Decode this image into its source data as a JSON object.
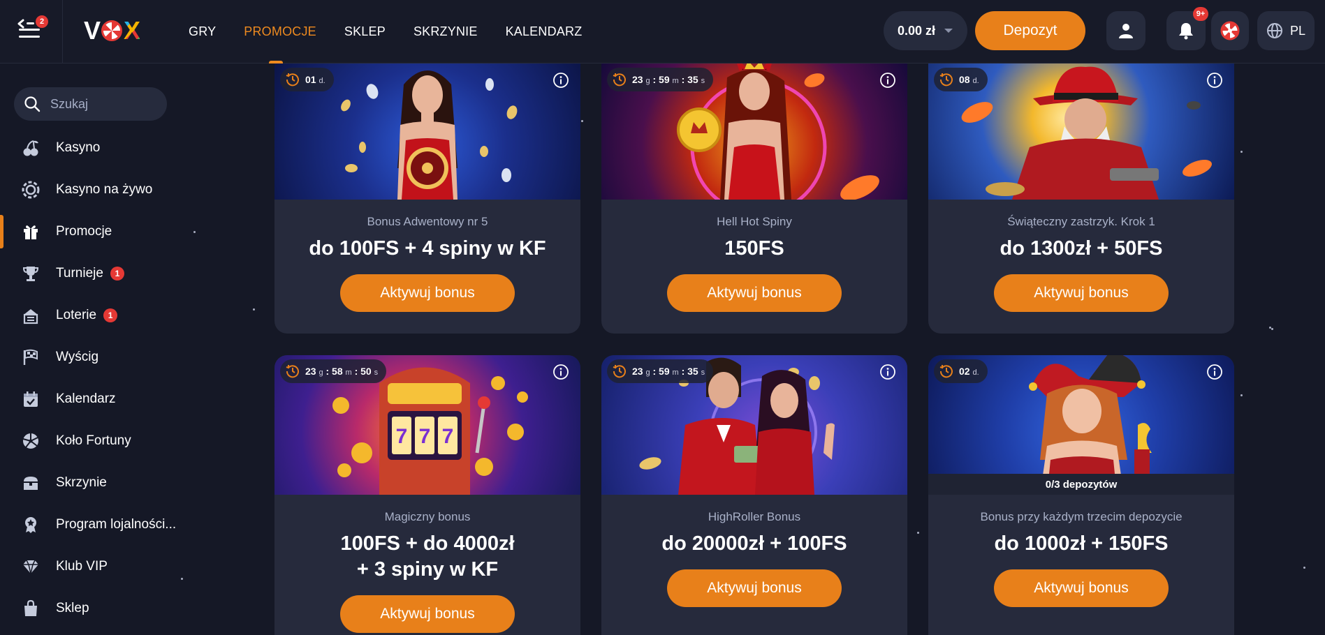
{
  "header": {
    "menu_badge": "2",
    "logo": "VOX",
    "nav": [
      "GRY",
      "PROMOCJE",
      "SKLEP",
      "SKRZYNIE",
      "KALENDARZ"
    ],
    "active_nav": "PROMOCJE",
    "balance": "0.00 zł",
    "deposit_label": "Depozyt",
    "notif_badge": "9+",
    "lang": "PL",
    "accent": "#e8801a"
  },
  "sidebar": {
    "search_placeholder": "Szukaj",
    "items": [
      {
        "label": "Kasyno",
        "icon": "cherries-icon"
      },
      {
        "label": "Kasyno na żywo",
        "icon": "live-chip-icon"
      },
      {
        "label": "Promocje",
        "icon": "gift-icon"
      },
      {
        "label": "Turnieje",
        "icon": "trophy-icon",
        "badge": "1"
      },
      {
        "label": "Loterie",
        "icon": "lottery-icon",
        "badge": "1"
      },
      {
        "label": "Wyścig",
        "icon": "race-flag-icon"
      },
      {
        "label": "Kalendarz",
        "icon": "calendar-icon"
      },
      {
        "label": "Koło Fortuny",
        "icon": "wheel-icon"
      },
      {
        "label": "Skrzynie",
        "icon": "chest-icon"
      },
      {
        "label": "Program lojalności...",
        "icon": "loyalty-badge-icon"
      },
      {
        "label": "Klub VIP",
        "icon": "diamond-icon"
      },
      {
        "label": "Sklep",
        "icon": "shop-bag-icon"
      }
    ]
  },
  "cards": [
    {
      "timer": {
        "d": "01",
        "d_unit": "d."
      },
      "subtitle": "Bonus Adwentowy nr 5",
      "title": "do 100FS + 4 spiny w KF",
      "button": "Aktywuj bonus"
    },
    {
      "timer": {
        "g": "23",
        "g_unit": "g",
        "m": "59",
        "m_unit": "m",
        "s": "35",
        "s_unit": "s"
      },
      "subtitle": "Hell Hot Spiny",
      "title": "150FS",
      "button": "Aktywuj bonus"
    },
    {
      "timer": {
        "d": "08",
        "d_unit": "d."
      },
      "subtitle": "Świąteczny zastrzyk. Krok 1",
      "title": "do 1300zł + 50FS",
      "button": "Aktywuj bonus"
    },
    {
      "timer": {
        "g": "23",
        "g_unit": "g",
        "m": "58",
        "m_unit": "m",
        "s": "50",
        "s_unit": "s"
      },
      "subtitle": "Magiczny bonus",
      "title_line1": "100FS + do 4000zł",
      "title_line2": "+ 3 spiny w KF",
      "button": "Aktywuj bonus"
    },
    {
      "timer": {
        "g": "23",
        "g_unit": "g",
        "m": "59",
        "m_unit": "m",
        "s": "35",
        "s_unit": "s"
      },
      "subtitle": "HighRoller Bonus",
      "title": "do 20000zł + 100FS",
      "button": "Aktywuj bonus"
    },
    {
      "timer": {
        "d": "02",
        "d_unit": "d."
      },
      "deposit_progress": "0/3 depozytów",
      "subtitle": "Bonus przy każdym trzecim depozycie",
      "title": "do 1000zł + 150FS",
      "button": "Aktywuj bonus"
    }
  ]
}
